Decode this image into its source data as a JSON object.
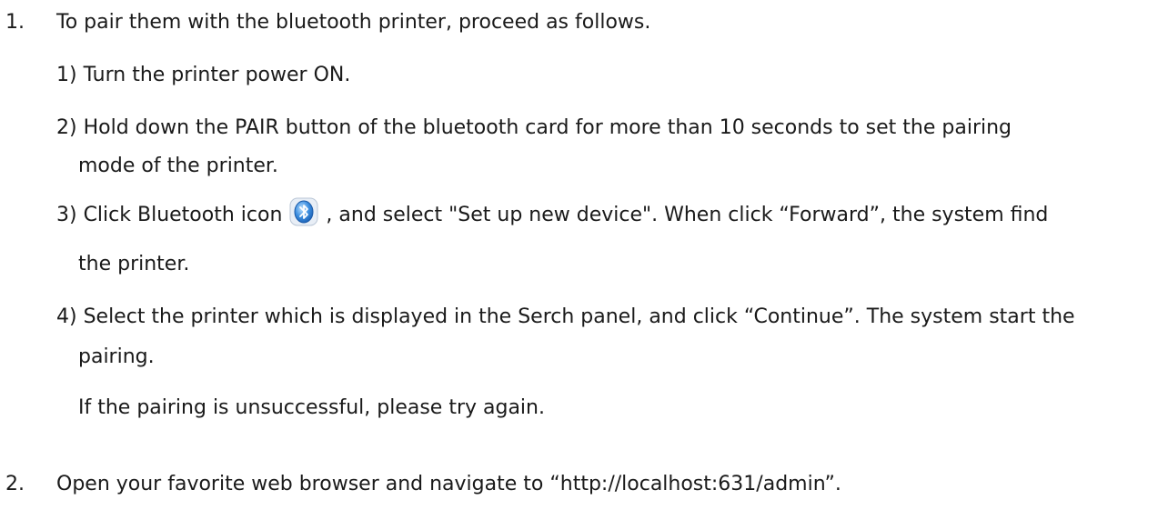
{
  "items": [
    {
      "number": "1.",
      "text": "To pair them with the bluetooth printer, proceed as follows.",
      "steps": [
        {
          "text": "1) Turn the printer power ON."
        },
        {
          "line1": "2) Hold down the PAIR button of the bluetooth card for more than 10 seconds to set the pairing",
          "line2": "mode of the printer."
        },
        {
          "before_icon": "3) Click  Bluetooth icon",
          "after_icon": ", and select \"Set up new device\".  When click “Forward”, the system find",
          "line2": "the printer.",
          "icon": "bluetooth-icon"
        },
        {
          "line1": "4) Select the printer which is displayed in the Serch panel, and click  “Continue”.  The system start the",
          "line2": "pairing."
        }
      ],
      "note": "If the pairing is unsuccessful, please try again."
    },
    {
      "number": "2.",
      "text": "Open your favorite web browser and navigate to “http://localhost:631/admin”."
    }
  ],
  "colors": {
    "text": "#1a1a1a",
    "bluetooth_blue": "#2f7fd6"
  }
}
